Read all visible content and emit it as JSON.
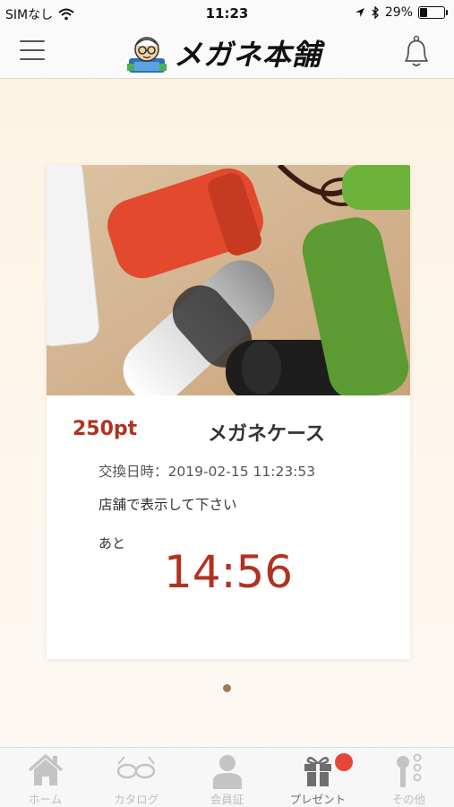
{
  "status_bar": {
    "carrier": "SIMなし",
    "time": "11:23",
    "battery": "29%",
    "battery_level": 0.29
  },
  "header": {
    "logo_text": "メガネ本舗",
    "menu_icon": "hamburger-menu-icon",
    "bell_icon": "bell-icon"
  },
  "card": {
    "points": "250pt",
    "item_name": "メガネケース",
    "exchange_line": "交換日時：2019-02-15 11:23:53",
    "notice": "店舗で表示して下さい",
    "remaining_label": "あと",
    "countdown": "14:56"
  },
  "tabs": [
    {
      "label": "ホーム",
      "icon": "home-icon",
      "active": false
    },
    {
      "label": "カタログ",
      "icon": "glasses-icon",
      "active": false
    },
    {
      "label": "会員証",
      "icon": "person-icon",
      "active": false
    },
    {
      "label": "プレゼント",
      "icon": "gift-icon",
      "active": true
    },
    {
      "label": "その他",
      "icon": "more-icon",
      "active": false
    }
  ],
  "colors": {
    "accent": "#b23221",
    "badge": "#e6463a",
    "pager": "#9b7c55"
  }
}
